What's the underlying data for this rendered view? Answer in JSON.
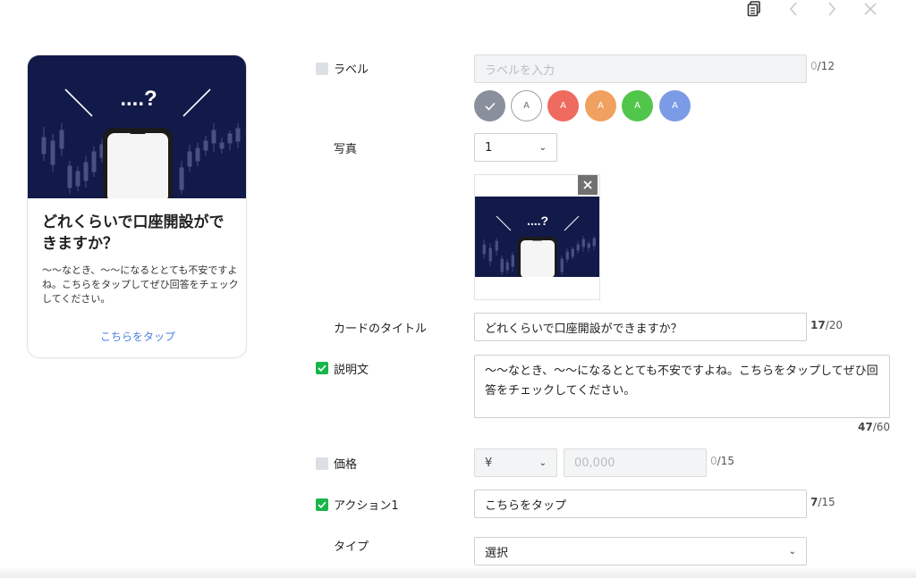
{
  "toolbar": {
    "copy_icon": "copy-icon",
    "prev_icon": "chevron-left-icon",
    "next_icon": "chevron-right-icon",
    "close_icon": "close-icon"
  },
  "preview": {
    "image_text": "....?",
    "title": "どれくらいで口座開設ができますか？",
    "description": "〜〜なとき、〜〜になるととても不安ですよね。こちらをタップしてぜひ回答をチェックしてください。",
    "action_label": "こちらをタップ"
  },
  "form": {
    "label": {
      "title": "ラベル",
      "placeholder": "ラベルを入力",
      "count": "0",
      "max": "/12",
      "checked": false,
      "swatches": [
        {
          "letter": "",
          "color": "#8a8f9c",
          "selected": true
        },
        {
          "letter": "A",
          "color": "#ffffff",
          "selected": false
        },
        {
          "letter": "A",
          "color": "#ef6a5f",
          "selected": false
        },
        {
          "letter": "A",
          "color": "#f0a160",
          "selected": false
        },
        {
          "letter": "A",
          "color": "#52c64a",
          "selected": false
        },
        {
          "letter": "A",
          "color": "#7b9be6",
          "selected": false
        }
      ]
    },
    "photo": {
      "title": "写真",
      "selected": "1",
      "image_text": "....?"
    },
    "card_title": {
      "title": "カードのタイトル",
      "value": "どれくらいで口座開設ができますか？",
      "count": "17",
      "max": "/20"
    },
    "description": {
      "title": "説明文",
      "checked": true,
      "value": "〜〜なとき、〜〜になるととても不安ですよね。こちらをタップしてぜひ回答をチェックしてください。",
      "count": "47",
      "max": "/60"
    },
    "price": {
      "title": "価格",
      "checked": false,
      "currency": "¥",
      "placeholder": "00,000",
      "count": "0",
      "max": "/15"
    },
    "action1": {
      "title": "アクション1",
      "checked": true,
      "value": "こちらをタップ",
      "count": "7",
      "max": "/15"
    },
    "type": {
      "title": "タイプ",
      "selected": "選択"
    }
  },
  "colors": {
    "accent_link": "#4a7fe0",
    "checkbox_on": "#17b54a",
    "image_bg": "#121a4a"
  }
}
